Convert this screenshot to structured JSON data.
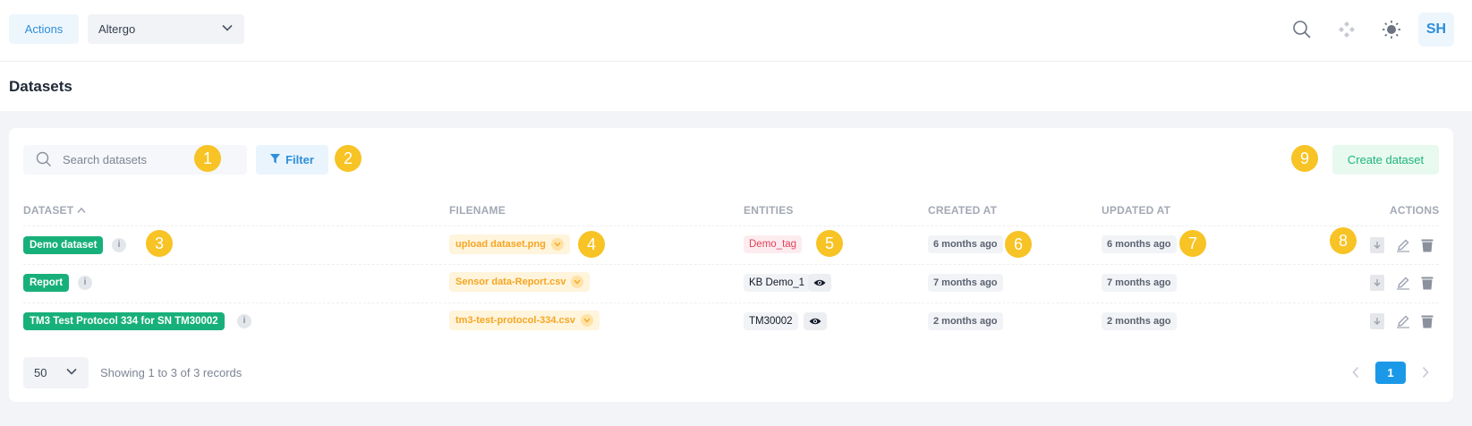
{
  "topbar": {
    "actions_label": "Actions",
    "org_selected": "Altergo",
    "avatar_initials": "SH",
    "icons": [
      "search-icon",
      "apps-icon",
      "sun-icon"
    ]
  },
  "page": {
    "title": "Datasets"
  },
  "toolbar": {
    "search_placeholder": "Search datasets",
    "filter_label": "Filter",
    "create_label": "Create dataset"
  },
  "markers": [
    "1",
    "2",
    "3",
    "4",
    "5",
    "6",
    "7",
    "8",
    "9"
  ],
  "table": {
    "headers": {
      "dataset": "DATASET",
      "filename": "FILENAME",
      "entities": "ENTITIES",
      "created_at": "CREATED AT",
      "updated_at": "UPDATED AT",
      "actions": "ACTIONS"
    },
    "rows": [
      {
        "name": "Demo dataset",
        "filename": "upload dataset.png",
        "entity": "Demo_tag",
        "entity_style": "tag",
        "created": "6 months ago",
        "updated": "6 months ago"
      },
      {
        "name": "Report",
        "filename": "Sensor data-Report.csv",
        "entity": "KB Demo_1",
        "entity_style": "entity",
        "created": "7 months ago",
        "updated": "7 months ago"
      },
      {
        "name": "TM3 Test Protocol 334 for SN TM30002",
        "filename": "tm3-test-protocol-334.csv",
        "entity": "TM30002",
        "entity_style": "entity",
        "created": "2 months ago",
        "updated": "2 months ago"
      }
    ],
    "info_glyph": "i"
  },
  "footer": {
    "page_size": "50",
    "records_text": "Showing 1 to 3 of 3 records",
    "current_page": "1"
  },
  "colors": {
    "accent": "#2d8fd9",
    "success": "#18b07a",
    "file_badge": "#f5a623",
    "tag": "#e0435b",
    "marker": "#f7c325"
  }
}
